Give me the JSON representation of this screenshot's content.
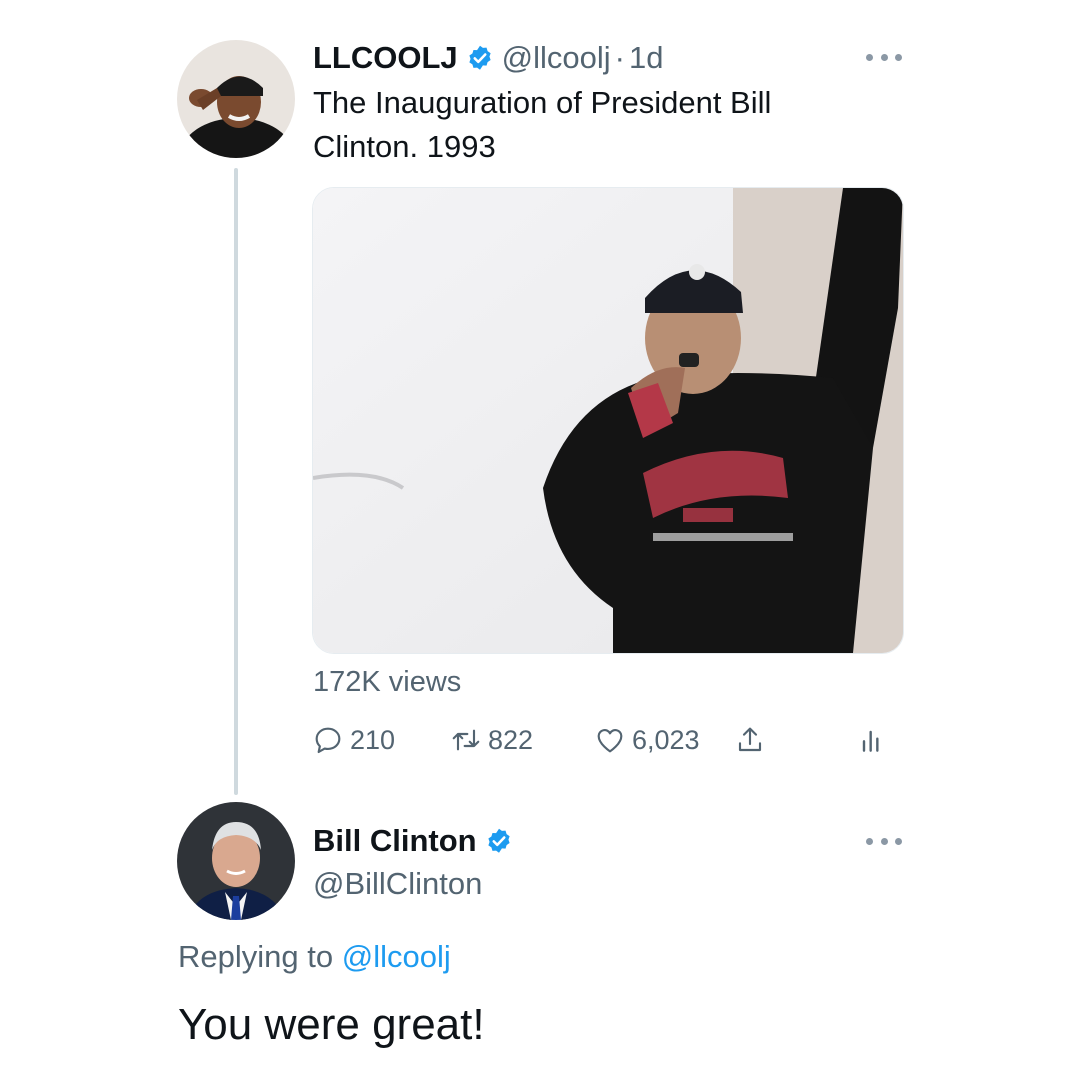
{
  "colors": {
    "accent": "#1d9bf0",
    "secondary_text": "#536471",
    "primary_text": "#0f1419",
    "thread_line": "#cfd9de"
  },
  "original_tweet": {
    "author_name": "LLCOOLJ",
    "verified": true,
    "handle": "@llcoolj",
    "separator": "·",
    "time": "1d",
    "text_line1": "The Inauguration of President Bill",
    "text_line2": "Clinton. 1993",
    "media_alt": "video",
    "views": "172K views",
    "actions": {
      "reply_count": "210",
      "retweet_count": "822",
      "like_count": "6,023",
      "icons": [
        "reply-icon",
        "retweet-icon",
        "like-icon",
        "share-icon",
        "analytics-icon"
      ]
    }
  },
  "reply_tweet": {
    "author_name": "Bill Clinton",
    "verified": true,
    "handle": "@BillClinton",
    "replying_prefix": "Replying to",
    "replying_mention": "@llcoolj",
    "text": "You were great!"
  }
}
